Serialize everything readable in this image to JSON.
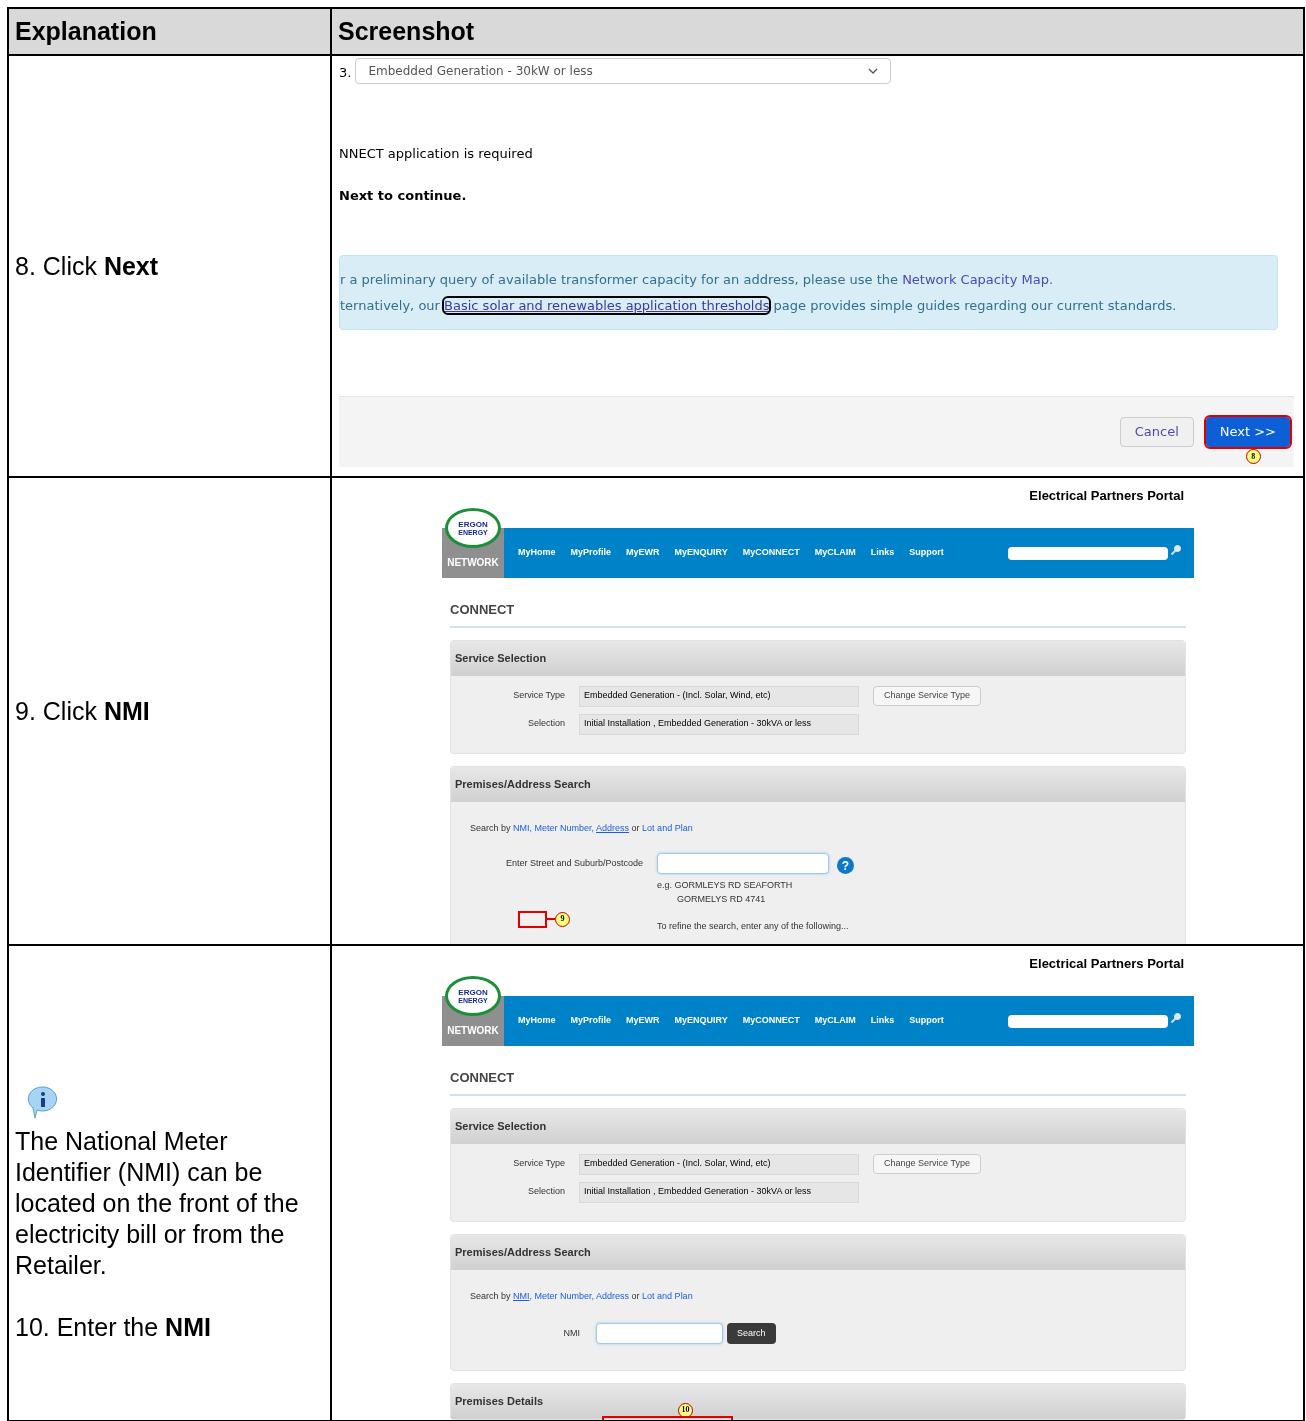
{
  "table": {
    "columns": [
      "Explanation",
      "Screenshot"
    ]
  },
  "rows": [
    {
      "explanation": {
        "step": "8. Click **Next**"
      },
      "screenshot": {
        "kind": "form_end",
        "select": {
          "number": "3.",
          "value": "Embedded Generation - 30kW or less"
        },
        "lines": [
          {
            "text": "NNECT application is required",
            "bold": false
          },
          {
            "text": "Next to continue.",
            "bold": true
          }
        ],
        "notice": [
          [
            {
              "kind": "text",
              "text": "r a preliminary query of available transformer capacity for an address, please use the "
            },
            {
              "kind": "link",
              "text": "Network Capacity Map",
              "focused": false
            },
            {
              "kind": "text",
              "text": "."
            }
          ],
          [
            {
              "kind": "text",
              "text": "ternatively, our "
            },
            {
              "kind": "link",
              "text": "Basic solar and renewables application thresholds",
              "focused": true
            },
            {
              "kind": "text",
              "text": " page provides simple guides regarding our current standards."
            }
          ]
        ],
        "buttons": [
          {
            "label": "Cancel",
            "primary": false,
            "highlighted": false
          },
          {
            "label": "Next >>",
            "primary": true,
            "highlighted": true
          }
        ],
        "marker": "8"
      }
    },
    {
      "explanation": {
        "step": "9. Click **NMI**"
      },
      "screenshot": {
        "kind": "portal",
        "portal_title": "Electrical Partners Portal",
        "logo": {
          "top": "ERGON",
          "bottom": "ENERGY",
          "label": "NETWORK"
        },
        "nav": [
          "MyHome",
          "MyProfile",
          "MyEWR",
          "MyENQUIRY",
          "MyCONNECT",
          "MyCLAIM",
          "Links",
          "Support"
        ],
        "section": "CONNECT",
        "service_panel": {
          "title": "Service Selection",
          "fields": [
            {
              "label": "Service Type",
              "value": "Embedded Generation - (Incl. Solar, Wind, etc)"
            },
            {
              "label": "Selection",
              "value": "Initial Installation , Embedded Generation - 30kVA or less"
            }
          ],
          "button": "Change Service Type"
        },
        "search_panel": {
          "title": "Premises/Address Search",
          "search_by": [
            {
              "kind": "text",
              "text": "Search by "
            },
            {
              "kind": "link",
              "text": "NMI",
              "selected": false
            },
            {
              "kind": "link",
              "text": ", Meter Number, ",
              "selected": false
            },
            {
              "kind": "link",
              "text": "Address",
              "selected": true
            },
            {
              "kind": "text",
              "text": " or "
            },
            {
              "kind": "link",
              "text": "Lot and Plan",
              "selected": false
            }
          ],
          "input": {
            "kind": "address",
            "label": "Enter Street and Suburb/Postcode",
            "help": "?",
            "hint_lines": [
              "e.g. GORMLEYS RD SEAFORTH",
              "GORMELYS RD 4741"
            ],
            "refine": "To refine the search, enter any of the following..."
          },
          "marker": "9"
        }
      }
    },
    {
      "explanation": {
        "note": "The National Meter Identifier (NMI) can be located on the front of the electricity bill or from the Retailer.",
        "step": "10. Enter the **NMI**"
      },
      "screenshot": {
        "kind": "portal",
        "portal_title": "Electrical Partners Portal",
        "logo": {
          "top": "ERGON",
          "bottom": "ENERGY",
          "label": "NETWORK"
        },
        "nav": [
          "MyHome",
          "MyProfile",
          "MyEWR",
          "MyENQUIRY",
          "MyCONNECT",
          "MyCLAIM",
          "Links",
          "Support"
        ],
        "section": "CONNECT",
        "service_panel": {
          "title": "Service Selection",
          "fields": [
            {
              "label": "Service Type",
              "value": "Embedded Generation - (Incl. Solar, Wind, etc)"
            },
            {
              "label": "Selection",
              "value": "Initial Installation , Embedded Generation - 30kVA or less"
            }
          ],
          "button": "Change Service Type"
        },
        "search_panel": {
          "title": "Premises/Address Search",
          "search_by": [
            {
              "kind": "text",
              "text": "Search by "
            },
            {
              "kind": "link",
              "text": "NMI",
              "selected": true
            },
            {
              "kind": "link",
              "text": ", Meter Number, Address",
              "selected": false
            },
            {
              "kind": "text",
              "text": " or "
            },
            {
              "kind": "link",
              "text": "Lot and Plan",
              "selected": false
            }
          ],
          "input": {
            "kind": "nmi",
            "label": "NMI",
            "button": "Search"
          }
        },
        "details_panel": {
          "title": "Premises Details",
          "marker": "10"
        }
      }
    }
  ]
}
